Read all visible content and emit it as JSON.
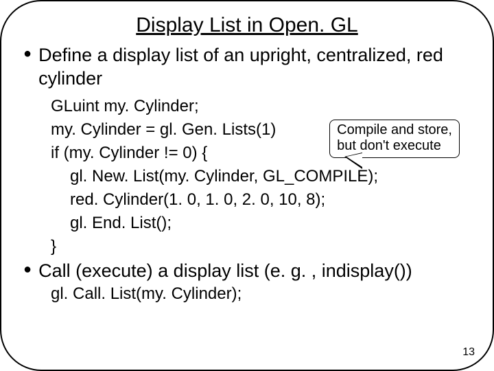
{
  "title": "Display List in Open. GL",
  "bullets": [
    "Define a display list of an upright, centralized, red cylinder",
    "Call (execute) a display list (e. g. , indisplay())"
  ],
  "code": {
    "l1": "GLuint my. Cylinder;",
    "l2": "my. Cylinder = gl. Gen. Lists(1)",
    "l3": "if (my. Cylinder != 0) {",
    "l4": "gl. New. List(my. Cylinder, GL_COMPILE);",
    "l5": "red. Cylinder(1. 0, 1. 0, 2. 0, 10, 8);",
    "l6": "gl. End. List();",
    "l7": "}"
  },
  "callout": {
    "line1": "Compile and store,",
    "line2": "but don't execute"
  },
  "tail_code": "gl. Call. List(my. Cylinder);",
  "page_number": "13"
}
